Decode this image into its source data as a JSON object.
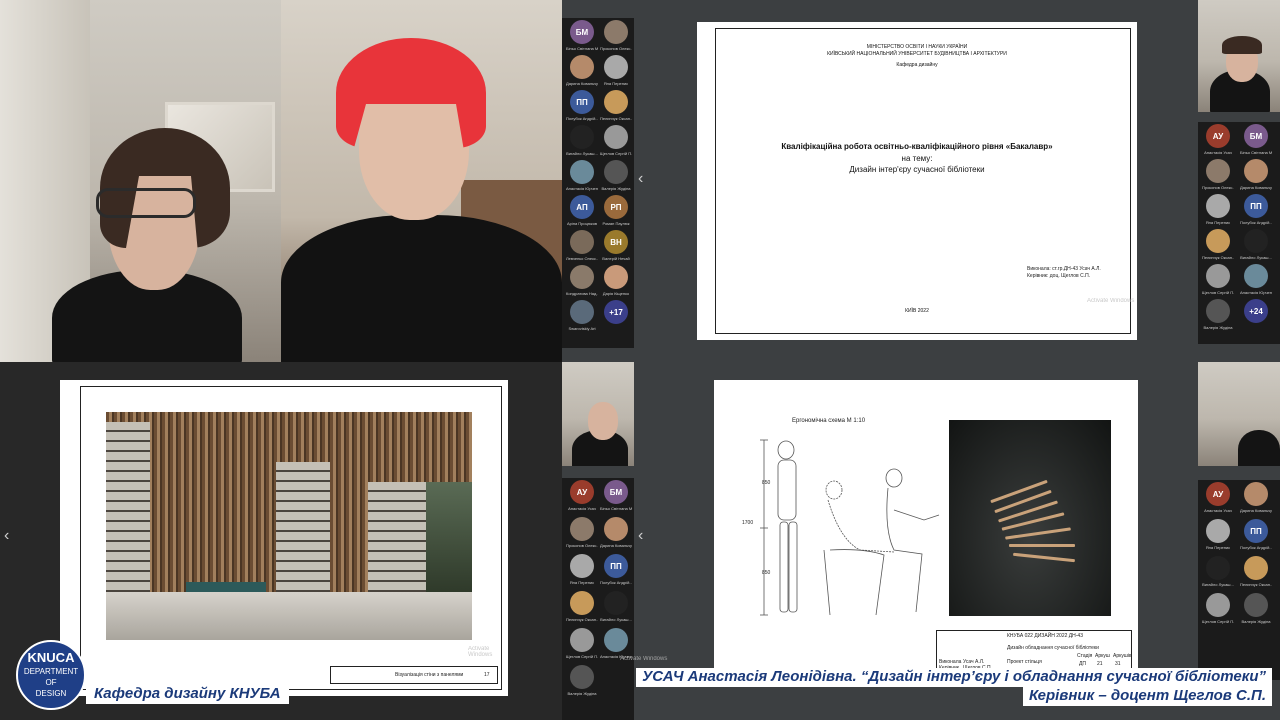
{
  "top_slide": {
    "ministry": "МІНІСТЕРСТВО ОСВІТИ І НАУКИ УКРАЇНИ",
    "university": "КИЇВСЬКИЙ НАЦІОНАЛЬНИЙ УНІВЕРСИТЕТ БУДІВНИЦТВА І АРХІТЕКТУРИ",
    "department": "Кафедра дизайну",
    "title_line1": "Кваліфікаційна робота освітньо-кваліфікаційного рівня «Бакалавр»",
    "title_line2": "на тему:",
    "title_line3": "Дизайн інтер'єру сучасної бібліотеки",
    "author_line1": "Виконала: ст.гр.ДН-43 Усач А.Л.",
    "author_line2": "Керівник: доц. Щеглов С.П.",
    "city_year": "КИЇВ 2022",
    "watermark": "Activate Windows"
  },
  "bottom_left_slide": {
    "stamp_caption": "Візуалізація стіни з панелями",
    "sheet_number": "17",
    "watermark": "Activate Windows"
  },
  "bottom_right_slide": {
    "ergo_title": "Ергономічна схема М 1:10",
    "dim_1700": "1700",
    "dim_850a": "850",
    "dim_850b": "850",
    "stamp_code": "КНУБА 022 ДИЗАЙН 2022 ДН-43",
    "stamp_project": "Дизайн обладнання сучасної бібліотеки",
    "stamp_sheet": "Проект стільця",
    "stamp_rows": [
      "Виконала",
      "Керівник"
    ],
    "stamp_names": [
      "Усач А.Л.",
      "Щеглов С.П."
    ],
    "stamp_cols": [
      "Стадія",
      "Аркуш",
      "Аркушів"
    ],
    "stamp_vals": [
      "ДП",
      "21",
      "31"
    ],
    "watermark": "Activate Windows"
  },
  "gallery_top_left": {
    "participants": [
      {
        "initials": "БМ",
        "name": "Біньо Світлана М.",
        "color": "#7a5a8c"
      },
      {
        "initials": "",
        "name": "Прокопов Олекс...",
        "color": "#8c7a6a"
      },
      {
        "initials": "",
        "name": "Дарина Ковальчук",
        "color": "#b58a6a"
      },
      {
        "initials": "",
        "name": "Яна Перепис",
        "color": "#a9a9a9"
      },
      {
        "initials": "ПП",
        "name": "Полубок Андрій...",
        "color": "#3c5a9a"
      },
      {
        "initials": "",
        "name": "Пелипчук Оксан...",
        "color": "#c79a5a"
      },
      {
        "initials": "",
        "name": "Вигайло Лукаш...",
        "color": "#222"
      },
      {
        "initials": "",
        "name": "Щеглов Сергій П...",
        "color": "#999"
      },
      {
        "initials": "",
        "name": "Анастасія Юрчен...",
        "color": "#6a8a9a"
      },
      {
        "initials": "",
        "name": "Валерія Жудіна",
        "color": "#555"
      },
      {
        "initials": "АП",
        "name": "Аріна Процюков",
        "color": "#3c5a9a"
      },
      {
        "initials": "РП",
        "name": "Роман Паулюк",
        "color": "#9a6a3c"
      },
      {
        "initials": "",
        "name": "Левченко Олекс...",
        "color": "#7a6a5a"
      },
      {
        "initials": "ВН",
        "name": "Валерій Нечай",
        "color": "#9a7a2c"
      },
      {
        "initials": "",
        "name": "Кондратова Над...",
        "color": "#8a7a6a"
      },
      {
        "initials": "",
        "name": "Дарія Кіщенко",
        "color": "#c99a7a"
      },
      {
        "initials": "",
        "name": "Swaroviskiy Art",
        "color": "#5a6a7a"
      }
    ],
    "more_label": "+17"
  },
  "gallery_top_right": {
    "participants": [
      {
        "initials": "АУ",
        "name": "Анастасія Усач",
        "color": "#9a3c2c"
      },
      {
        "initials": "БМ",
        "name": "Біньо Світлана М.",
        "color": "#7a5a8c"
      },
      {
        "initials": "",
        "name": "Прокопов Олекс...",
        "color": "#8c7a6a"
      },
      {
        "initials": "",
        "name": "Дарина Ковальчук",
        "color": "#b58a6a"
      },
      {
        "initials": "",
        "name": "Яна Перепис",
        "color": "#a9a9a9"
      },
      {
        "initials": "ПП",
        "name": "Полубок Андрій...",
        "color": "#3c5a9a"
      },
      {
        "initials": "",
        "name": "Пелипчук Оксан...",
        "color": "#c79a5a"
      },
      {
        "initials": "",
        "name": "Вигайло Лукаш...",
        "color": "#222"
      },
      {
        "initials": "",
        "name": "Щеглов Сергій П...",
        "color": "#999"
      },
      {
        "initials": "",
        "name": "Анастасія Юрчен...",
        "color": "#6a8a9a"
      },
      {
        "initials": "",
        "name": "Валерія Жудіна",
        "color": "#555"
      }
    ],
    "more_label": "+24"
  },
  "gallery_bottom_left": {
    "participants": [
      {
        "initials": "АУ",
        "name": "Анастасія Усач",
        "color": "#9a3c2c"
      },
      {
        "initials": "БМ",
        "name": "Біньо Світлана М.",
        "color": "#7a5a8c"
      },
      {
        "initials": "",
        "name": "Прокопов Олекс...",
        "color": "#8c7a6a"
      },
      {
        "initials": "",
        "name": "Дарина Ковальчук",
        "color": "#b58a6a"
      },
      {
        "initials": "",
        "name": "Яна Перепис",
        "color": "#a9a9a9"
      },
      {
        "initials": "ПП",
        "name": "Полубок Андрій...",
        "color": "#3c5a9a"
      },
      {
        "initials": "",
        "name": "Пелипчук Оксан...",
        "color": "#c79a5a"
      },
      {
        "initials": "",
        "name": "Вигайло Лукаш...",
        "color": "#222"
      },
      {
        "initials": "",
        "name": "Щеглов Сергій П...",
        "color": "#999"
      },
      {
        "initials": "",
        "name": "Анастасія Юрчен...",
        "color": "#6a8a9a"
      },
      {
        "initials": "",
        "name": "Валерія Жудіна",
        "color": "#555"
      }
    ]
  },
  "gallery_bottom_right": {
    "participants": [
      {
        "initials": "АУ",
        "name": "Анастасія Усач",
        "color": "#9a3c2c"
      },
      {
        "initials": "",
        "name": "Дарина Ковальчук",
        "color": "#b58a6a"
      },
      {
        "initials": "",
        "name": "Яна Перепис",
        "color": "#a9a9a9"
      },
      {
        "initials": "ПП",
        "name": "Полубок Андрій...",
        "color": "#3c5a9a"
      },
      {
        "initials": "",
        "name": "Вигайло Лукаш...",
        "color": "#222"
      },
      {
        "initials": "",
        "name": "Пелипчук Оксан...",
        "color": "#c79a5a"
      },
      {
        "initials": "",
        "name": "Щеглов Сергій П...",
        "color": "#999"
      },
      {
        "initials": "",
        "name": "Валерія Жудіна",
        "color": "#555"
      }
    ]
  },
  "branding": {
    "logo_line1": "KNUCA",
    "logo_line2": "DEPARTMENT",
    "logo_line3": "OF",
    "logo_line4": "DESIGN",
    "caption_left": "Кафедра дизайну КНУБА",
    "caption_right_line1": "УСАЧ Анастасія Леонідівна. “Дизайн інтер’єру і обладнання сучасної бібліотеки”",
    "caption_right_line2": "Керівник – доцент Щеглов С.П."
  }
}
